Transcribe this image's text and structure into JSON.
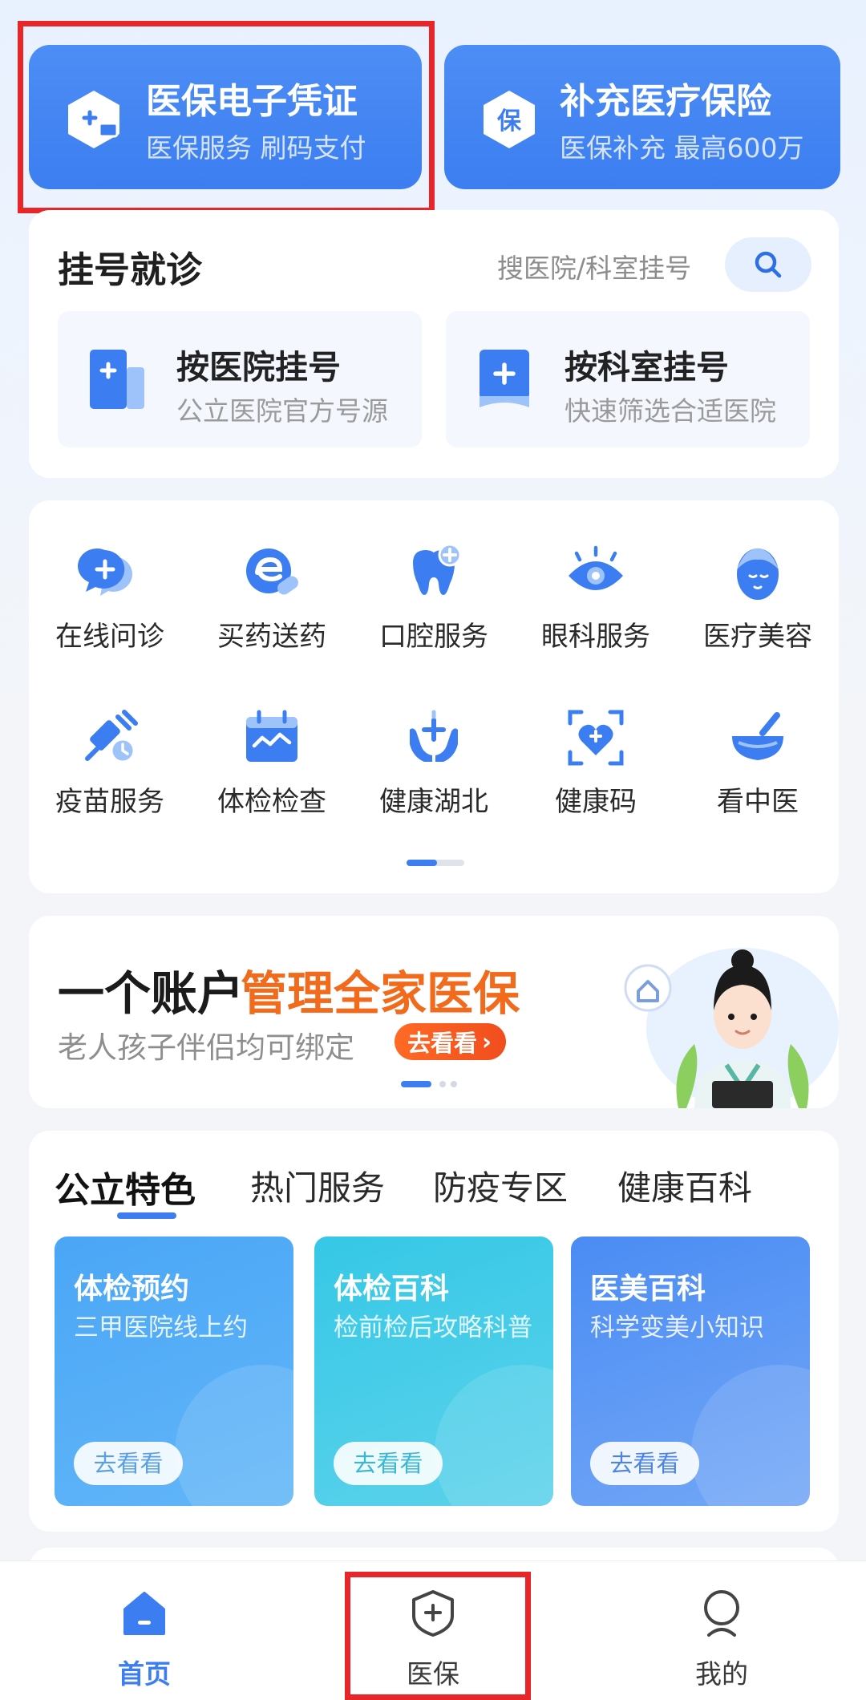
{
  "colors": {
    "primary": "#3c7ef1",
    "accent_orange": "#f26a1b",
    "highlight": "#e8262a"
  },
  "top_cards": [
    {
      "title": "医保电子凭证",
      "subtitle": "医保服务 刷码支付",
      "icon": "medical-card-hex-icon"
    },
    {
      "title": "补充医疗保险",
      "subtitle": "医保补充 最高600万",
      "icon": "insurance-shield-hex-icon",
      "badge": "保"
    }
  ],
  "registration": {
    "title": "挂号就诊",
    "search_hint": "搜医院/科室挂号",
    "search_icon": "search-icon",
    "options": [
      {
        "title": "按医院挂号",
        "subtitle": "公立医院官方号源",
        "icon": "hospital-icon"
      },
      {
        "title": "按科室挂号",
        "subtitle": "快速筛选合适医院",
        "icon": "department-icon"
      }
    ]
  },
  "services": [
    {
      "label": "在线问诊",
      "icon": "online-consult-icon"
    },
    {
      "label": "买药送药",
      "icon": "medicine-delivery-icon"
    },
    {
      "label": "口腔服务",
      "icon": "tooth-icon"
    },
    {
      "label": "眼科服务",
      "icon": "eye-icon"
    },
    {
      "label": "医疗美容",
      "icon": "beauty-face-icon"
    },
    {
      "label": "疫苗服务",
      "icon": "vaccine-icon"
    },
    {
      "label": "体检检查",
      "icon": "checkup-icon"
    },
    {
      "label": "健康湖北",
      "icon": "health-hands-icon"
    },
    {
      "label": "健康码",
      "icon": "health-code-icon"
    },
    {
      "label": "看中医",
      "icon": "tcm-mortar-icon"
    }
  ],
  "banner": {
    "title_plain": "一个账户",
    "title_accent": "管理全家医保",
    "subtitle": "老人孩子伴侣均可绑定",
    "button": "去看看"
  },
  "tabs": [
    {
      "label": "公立特色",
      "active": true
    },
    {
      "label": "热门服务",
      "active": false
    },
    {
      "label": "防疫专区",
      "active": false
    },
    {
      "label": "健康百科",
      "active": false
    }
  ],
  "feature_cards": [
    {
      "title": "体检预约",
      "subtitle": "三甲医院线上约",
      "button": "去看看"
    },
    {
      "title": "体检百科",
      "subtitle": "检前检后攻略科普",
      "button": "去看看"
    },
    {
      "title": "医美百科",
      "subtitle": "科学变美小知识",
      "button": "去看看"
    }
  ],
  "bottom_nav": [
    {
      "label": "首页",
      "icon": "home-icon",
      "active": true
    },
    {
      "label": "医保",
      "icon": "medical-shield-icon",
      "active": false
    },
    {
      "label": "我的",
      "icon": "profile-icon",
      "active": false
    }
  ]
}
